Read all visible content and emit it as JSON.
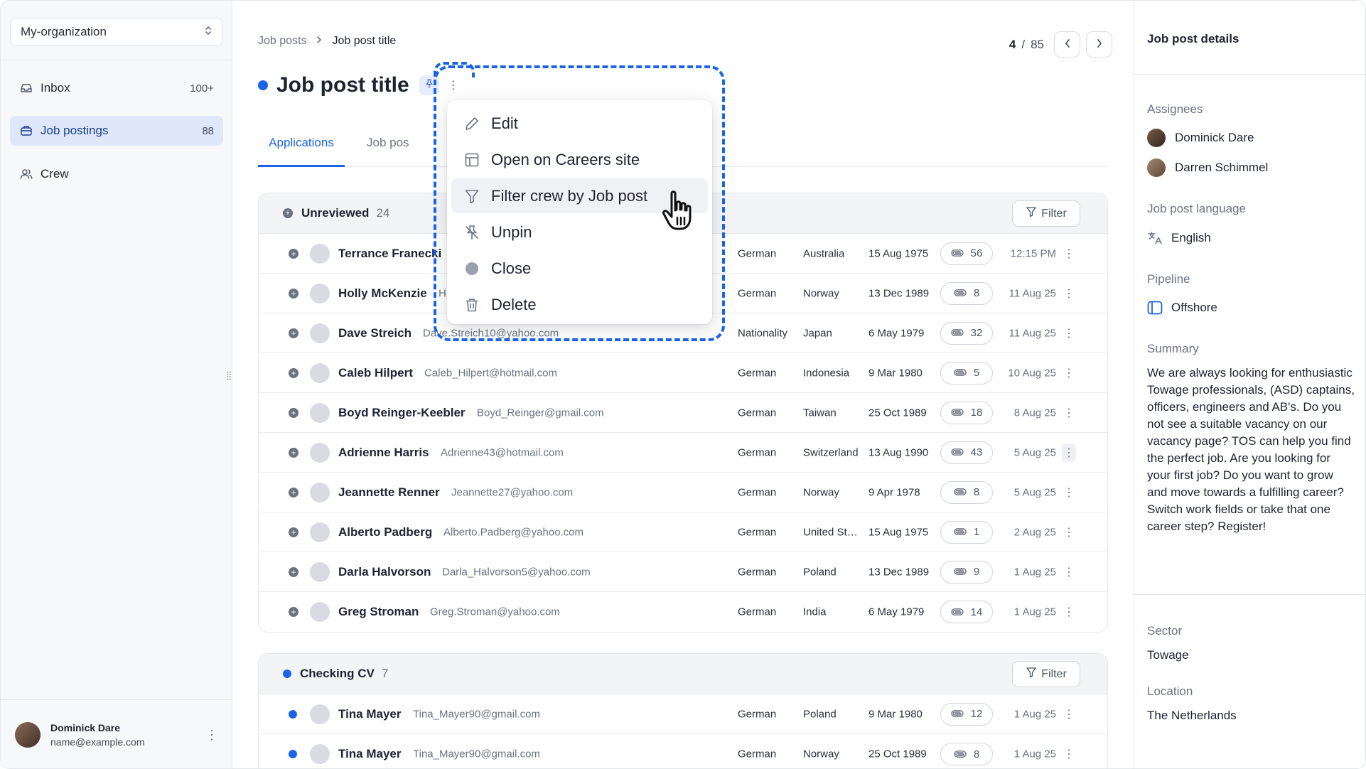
{
  "org": {
    "name": "My-organization"
  },
  "nav": [
    {
      "label": "Inbox",
      "count": "100+",
      "icon": "inbox-icon"
    },
    {
      "label": "Job postings",
      "count": "88",
      "icon": "briefcase-icon",
      "active": true
    },
    {
      "label": "Crew",
      "count": "",
      "icon": "users-icon"
    }
  ],
  "user": {
    "name": "Dominick Dare",
    "email": "name@example.com"
  },
  "breadcrumb": {
    "parent": "Job posts",
    "current": "Job post title"
  },
  "pager": {
    "current": "4",
    "separator": "/",
    "total": "85"
  },
  "title": "Job post title",
  "tabs": [
    "Applications",
    "Job pos"
  ],
  "menu": [
    {
      "label": "Edit",
      "icon": "pencil-icon"
    },
    {
      "label": "Open on Careers site",
      "icon": "layout-icon"
    },
    {
      "label": "Filter crew by Job post",
      "icon": "filter-icon"
    },
    {
      "label": "Unpin",
      "icon": "pin-off-icon"
    },
    {
      "label": "Close",
      "icon": "circle-icon"
    },
    {
      "label": "Delete",
      "icon": "trash-icon"
    }
  ],
  "groups": [
    {
      "title": "Unreviewed",
      "count": "24",
      "filter": "Filter",
      "dot_color": "#6b7280",
      "rows": [
        {
          "name": "Terrance Franecki",
          "email": "",
          "nationality": "German",
          "country": "Australia",
          "dob": "15 Aug 1975",
          "attachments": "56",
          "date": "12:15 PM"
        },
        {
          "name": "Holly McKenzie",
          "email": "H",
          "nationality": "German",
          "country": "Norway",
          "dob": "13 Dec 1989",
          "attachments": "8",
          "date": "11 Aug 25"
        },
        {
          "name": "Dave Streich",
          "email": "Dave.Streich10@yahoo.com",
          "nationality": "Nationality",
          "country": "Japan",
          "dob": "6 May 1979",
          "attachments": "32",
          "date": "11 Aug 25"
        },
        {
          "name": "Caleb Hilpert",
          "email": "Caleb_Hilpert@hotmail.com",
          "nationality": "German",
          "country": "Indonesia",
          "dob": "9 Mar 1980",
          "attachments": "5",
          "date": "10 Aug 25"
        },
        {
          "name": "Boyd Reinger-Keebler",
          "email": "Boyd_Reinger@gmail.com",
          "nationality": "German",
          "country": "Taiwan",
          "dob": "25 Oct 1989",
          "attachments": "18",
          "date": "8 Aug 25"
        },
        {
          "name": "Adrienne Harris",
          "email": "Adrienne43@hotmail.com",
          "nationality": "German",
          "country": "Switzerland",
          "dob": "13 Aug 1990",
          "attachments": "43",
          "date": "5  Aug 25"
        },
        {
          "name": "Jeannette Renner",
          "email": "Jeannette27@yahoo.com",
          "nationality": "German",
          "country": "Norway",
          "dob": "9 Apr 1978",
          "attachments": "8",
          "date": "5 Aug 25"
        },
        {
          "name": "Alberto Padberg",
          "email": "Alberto.Padberg@yahoo.com",
          "nationality": "German",
          "country": "United Sta...",
          "dob": "15 Aug 1975",
          "attachments": "1",
          "date": "2 Aug 25"
        },
        {
          "name": "Darla Halvorson",
          "email": "Darla_Halvorson5@yahoo.com",
          "nationality": "German",
          "country": "Poland",
          "dob": "13 Dec 1989",
          "attachments": "9",
          "date": "1 Aug 25"
        },
        {
          "name": "Greg Stroman",
          "email": "Greg.Stroman@yahoo.com",
          "nationality": "German",
          "country": "India",
          "dob": "6 May 1979",
          "attachments": "14",
          "date": "1 Aug 25"
        }
      ]
    },
    {
      "title": "Checking CV",
      "count": "7",
      "filter": "Filter",
      "dot_color": "#1d63e8",
      "rows": [
        {
          "name": "Tina Mayer",
          "email": "Tina_Mayer90@gmail.com",
          "nationality": "German",
          "country": "Poland",
          "dob": "9 Mar 1980",
          "attachments": "12",
          "date": "1 Aug 25"
        },
        {
          "name": "Tina Mayer",
          "email": "Tina_Mayer90@gmail.com",
          "nationality": "German",
          "country": "Norway",
          "dob": "25 Oct 1989",
          "attachments": "8",
          "date": "1 Aug 25"
        }
      ]
    }
  ],
  "details": {
    "title": "Job post details",
    "assignees_label": "Assignees",
    "assignees": [
      "Dominick Dare",
      "Darren Schimmel"
    ],
    "language_label": "Job post language",
    "language": "English",
    "pipeline_label": "Pipeline",
    "pipeline": "Offshore",
    "summary_label": "Summary",
    "summary": "We are always looking for enthusiastic Towage professionals, (ASD) captains, officers, engineers and AB's. Do you not see a suitable vacancy on our vacancy page? TOS can help you find the perfect job. Are you looking for your first job? Do you want to grow and move towards a fulfilling career? Switch work fields or take that one career step? Register!",
    "sector_label": "Sector",
    "sector": "Towage",
    "location_label": "Location",
    "location": "The Netherlands"
  },
  "colors": {
    "accent": "#1d63e8",
    "active_nav_bg": "#dfe8fb"
  }
}
